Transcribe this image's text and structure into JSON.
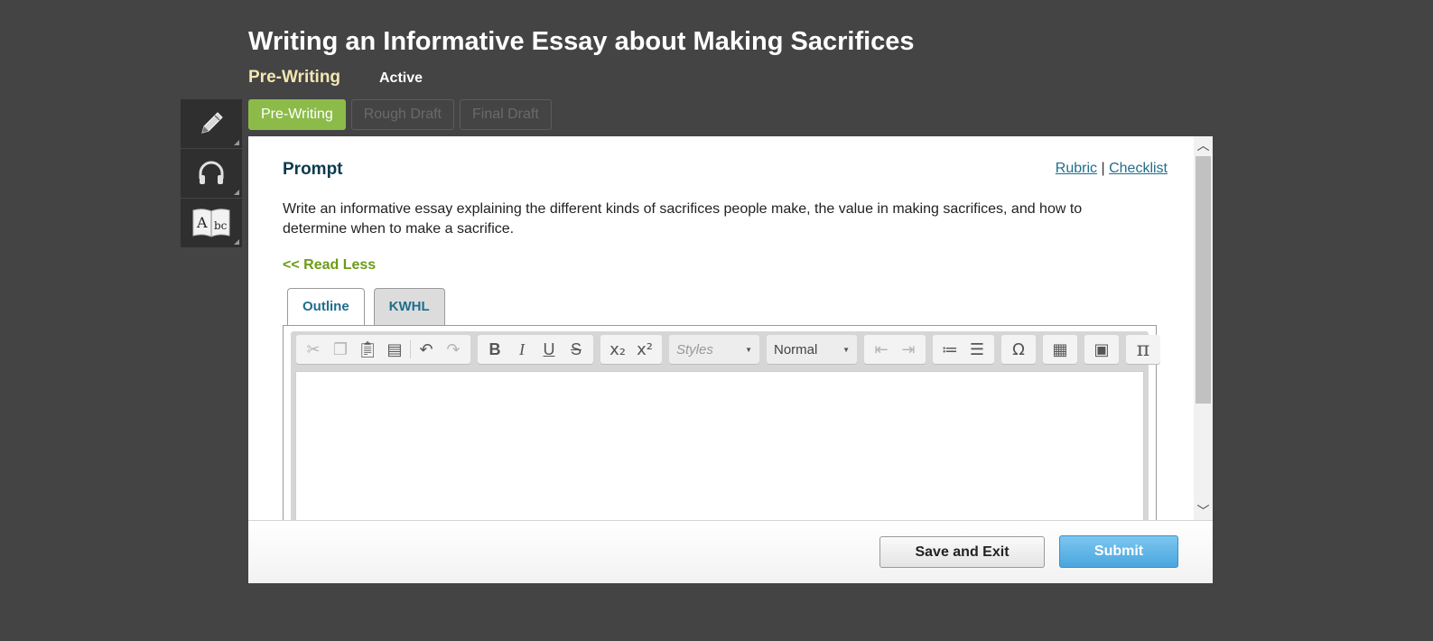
{
  "assignment": {
    "title": "Writing an Informative Essay about Making Sacrifices",
    "stage_label": "Pre-Writing",
    "status": "Active"
  },
  "tools": [
    {
      "icon": "pencil-icon"
    },
    {
      "icon": "headphones-icon"
    },
    {
      "icon": "dictionary-icon"
    }
  ],
  "stage_tabs": [
    {
      "label": "Pre-Writing",
      "active": true
    },
    {
      "label": "Rough Draft",
      "active": false
    },
    {
      "label": "Final Draft",
      "active": false
    }
  ],
  "prompt": {
    "heading": "Prompt",
    "rubric_link": "Rubric",
    "separator": "|",
    "checklist_link": "Checklist",
    "text": "Write an informative essay explaining the different kinds of sacrifices people make, the value in making sacrifices, and how to determine when to make a sacrifice.",
    "read_less": "<< Read Less"
  },
  "inner_tabs": [
    {
      "label": "Outline",
      "active": true
    },
    {
      "label": "KWHL",
      "active": false
    }
  ],
  "editor": {
    "styles_placeholder": "Styles",
    "format_value": "Normal",
    "toolbar_icons": [
      "cut-icon",
      "copy-icon",
      "paste-icon",
      "paste-text-icon",
      "undo-icon",
      "redo-icon",
      "bold-icon",
      "italic-icon",
      "underline-icon",
      "strikethrough-icon",
      "subscript-icon",
      "superscript-icon",
      "outdent-icon",
      "indent-icon",
      "numbered-list-icon",
      "bulleted-list-icon",
      "special-char-icon",
      "table-icon",
      "paste-word-icon",
      "math-icon"
    ]
  },
  "footer": {
    "save_label": "Save and Exit",
    "submit_label": "Submit"
  },
  "colors": {
    "background": "#444444",
    "stage_active": "#8dbb4a",
    "link": "#1f6e8c",
    "read_less": "#6c9b17",
    "submit": "#4aa6de"
  }
}
